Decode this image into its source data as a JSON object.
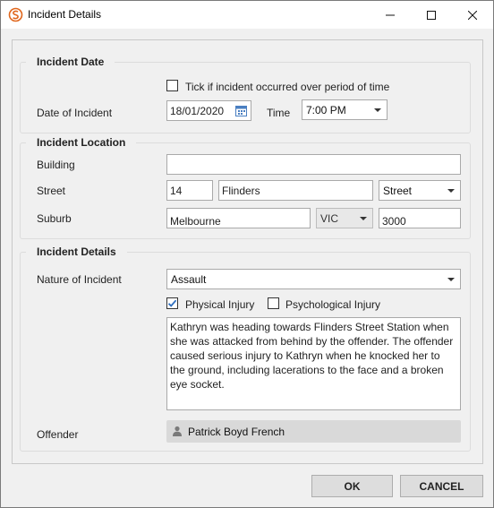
{
  "window": {
    "title": "Incident Details"
  },
  "incident_date": {
    "group_title": "Incident Date",
    "period_checkbox_label": "Tick if incident occurred over period of time",
    "period_checked": false,
    "date_label": "Date of Incident",
    "date_value": "18/01/2020",
    "time_label": "Time",
    "time_value": "7:00 PM"
  },
  "incident_location": {
    "group_title": "Incident Location",
    "building_label": "Building",
    "building_value": "",
    "street_label": "Street",
    "street_number": "14",
    "street_name": "Flinders",
    "street_type": "Street",
    "suburb_label": "Suburb",
    "suburb_value": "Melbourne",
    "state_value": "VIC",
    "postcode_value": "3000"
  },
  "incident_details": {
    "group_title": "Incident Details",
    "nature_label": "Nature of Incident",
    "nature_value": "Assault",
    "physical_injury_label": "Physical Injury",
    "physical_injury_checked": true,
    "psychological_injury_label": "Psychological Injury",
    "psychological_injury_checked": false,
    "description": "Kathryn was heading towards Flinders Street Station when she was attacked from behind by the offender. The offender caused serious injury to Kathryn when he knocked her to the ground, including lacerations to the face and a broken eye socket.",
    "offender_label": "Offender",
    "offender_name": "Patrick Boyd French"
  },
  "footer": {
    "ok_label": "OK",
    "cancel_label": "CANCEL"
  },
  "colors": {
    "accent": "#2f6fbf",
    "app_icon": "#e0661c"
  }
}
